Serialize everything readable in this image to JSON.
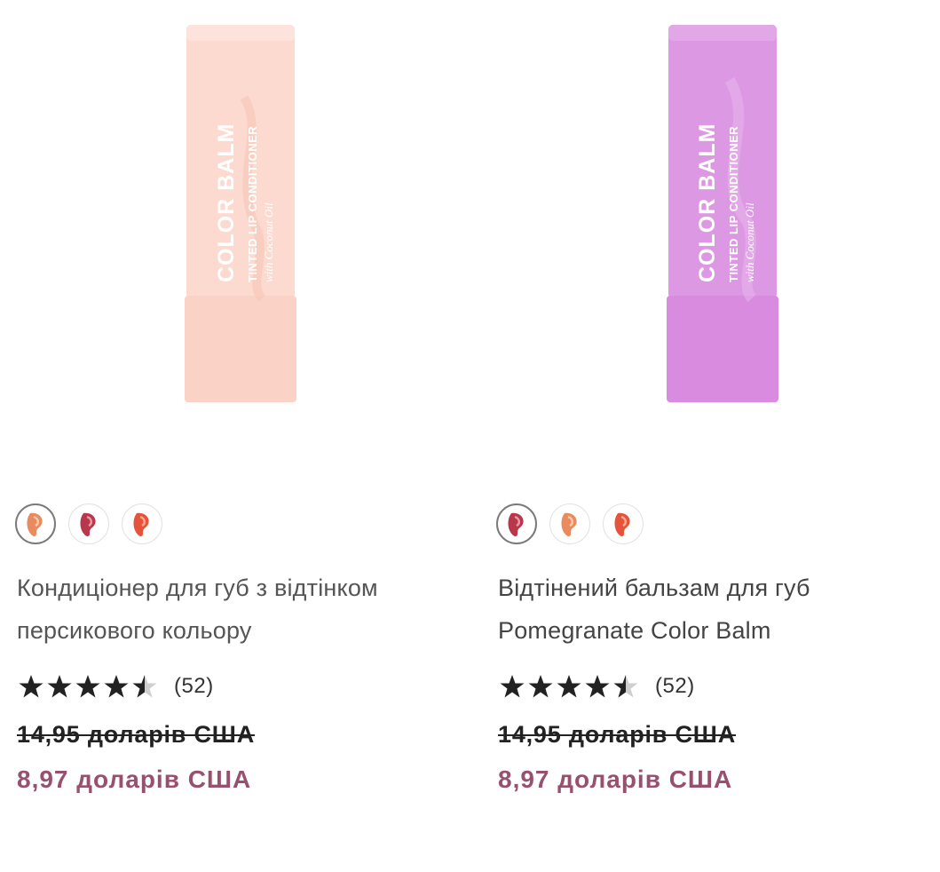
{
  "colors": {
    "sale_price": "#98506f",
    "star": "#222222",
    "star_empty": "#cfcfcf"
  },
  "products": [
    {
      "name_line1": "Кондиціонер для губ з відтінком",
      "name_line2": "персикового кольору",
      "image": {
        "brand": "COLOR BALM",
        "line": "TINTED LIP CONDITIONER",
        "sub": "with Coconut Oil",
        "body_color": "#fad2c6",
        "cap_color": "#fcdad0",
        "icon": "lip-balm-tube-icon"
      },
      "swatches": [
        {
          "name": "swatch-peach",
          "color": "#e98a5f",
          "selected": true
        },
        {
          "name": "swatch-pomegranate",
          "color": "#b8374a",
          "selected": false
        },
        {
          "name": "swatch-coral",
          "color": "#e5533a",
          "selected": false
        }
      ],
      "rating": 4.5,
      "review_count": "(52)",
      "price_original": "14,95 доларів США",
      "price_sale": "8,97 доларів США"
    },
    {
      "name_line1": "Відтінений бальзам для губ",
      "name_line2": "Pomegranate Color Balm",
      "image": {
        "brand": "COLOR BALM",
        "line": "TINTED LIP CONDITIONER",
        "sub": "with Coconut Oil",
        "body_color": "#d98be0",
        "cap_color": "#dd98e3",
        "icon": "lip-balm-tube-icon"
      },
      "swatches": [
        {
          "name": "swatch-pomegranate",
          "color": "#b8374a",
          "selected": true
        },
        {
          "name": "swatch-peach",
          "color": "#e98a5f",
          "selected": false
        },
        {
          "name": "swatch-coral",
          "color": "#e5533a",
          "selected": false
        }
      ],
      "rating": 4.5,
      "review_count": "(52)",
      "price_original": "14,95 доларів США",
      "price_sale": "8,97 доларів США"
    }
  ]
}
